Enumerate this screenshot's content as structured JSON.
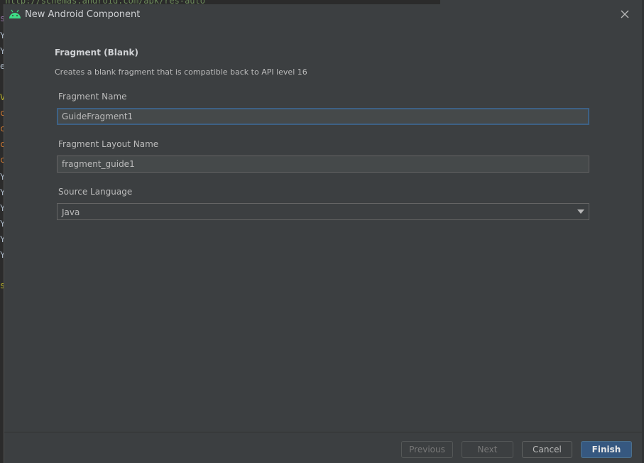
{
  "background_editor": {
    "top_line": "\"http://schemas.android.com/apk/res-auto\"",
    "gutter_chars": [
      "s",
      "Y",
      "Y",
      "e",
      "V",
      "c",
      "c",
      "c",
      "c",
      "Y",
      "Y",
      "Y",
      "Y",
      "Y",
      "Y",
      "s"
    ]
  },
  "dialog": {
    "title": "New Android Component",
    "icon": "android-icon",
    "close_icon": "close-icon"
  },
  "form": {
    "title": "Fragment (Blank)",
    "description": "Creates a blank fragment that is compatible back to API level 16",
    "fields": {
      "fragment_name": {
        "label": "Fragment Name",
        "value": "GuideFragment1"
      },
      "layout_name": {
        "label": "Fragment Layout Name",
        "value": "fragment_guide1"
      },
      "source_language": {
        "label": "Source Language",
        "value": "Java"
      }
    }
  },
  "buttons": {
    "previous": "Previous",
    "next": "Next",
    "cancel": "Cancel",
    "finish": "Finish"
  },
  "colors": {
    "dialog_bg": "#3c3f41",
    "focus_border": "#3d6185",
    "primary_button": "#365880",
    "android_green": "#3ddc84"
  }
}
